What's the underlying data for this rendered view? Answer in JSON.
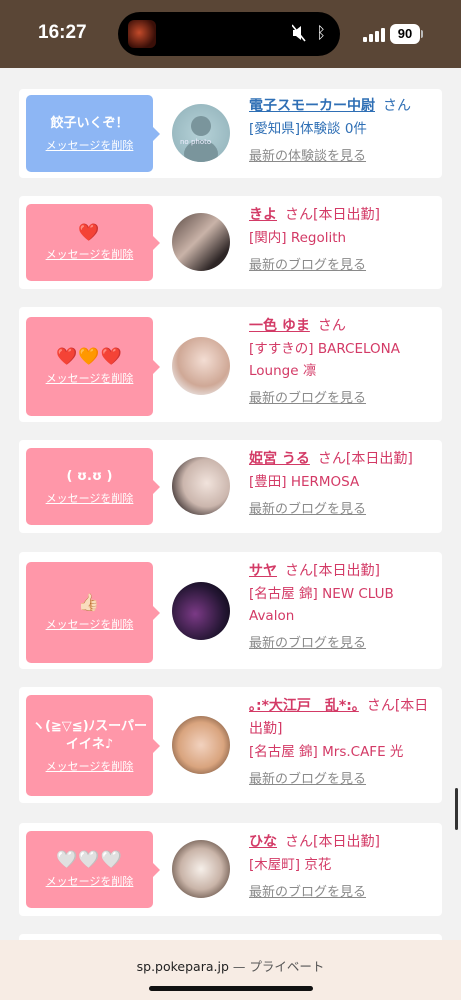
{
  "status_bar": {
    "time": "16:27",
    "battery": "90"
  },
  "entries": [
    {
      "message": "餃子いくぞ！",
      "delete_label": "メッセージを削除",
      "name": "電子スモーカー中尉",
      "suffix": "さん",
      "detail": "[愛知県]体験談 0件",
      "link": "最新の体験談を見る",
      "avatar_text": "no photo",
      "style": "blue"
    },
    {
      "message": "❤️",
      "delete_label": "メッセージを削除",
      "name": "きよ",
      "suffix": "さん[本日出勤]",
      "detail": "[関内] Regolith",
      "link": "最新のブログを見る",
      "style": "pink"
    },
    {
      "message": "❤️🧡❤️",
      "delete_label": "メッセージを削除",
      "name": "一色 ゆま",
      "suffix": "さん",
      "detail": "[すすきの] BARCELONA Lounge 凛",
      "link": "最新のブログを見る",
      "style": "pink"
    },
    {
      "message": "( ʊ.ʊ )",
      "delete_label": "メッセージを削除",
      "name": "姫宮 うる",
      "suffix": "さん[本日出勤]",
      "detail": "[豊田] HERMOSA",
      "link": "最新のブログを見る",
      "style": "pink"
    },
    {
      "message": "👍🏻",
      "delete_label": "メッセージを削除",
      "name": "サヤ",
      "suffix": "さん[本日出勤]",
      "detail": "[名古屋 錦] NEW CLUB Avalon",
      "link": "最新のブログを見る",
      "style": "pink"
    },
    {
      "message": "ヽ(≧▽≦)ﾉスーパーイイネ♪",
      "delete_label": "メッセージを削除",
      "name": "｡:*大江戸　乱*:｡",
      "suffix": "さん[本日出勤]",
      "detail": "[名古屋 錦] Mrs.CAFE 光",
      "link": "最新のブログを見る",
      "style": "pink"
    },
    {
      "message": "🤍🤍🤍",
      "delete_label": "メッセージを削除",
      "name": "ひな",
      "suffix": "さん[本日出勤]",
      "detail": "[木屋町] 京花",
      "link": "最新のブログを見る",
      "style": "pink"
    }
  ],
  "browser": {
    "domain": "sp.pokepara.jp",
    "separator": "—",
    "mode": "プライベート"
  },
  "colors": {
    "status_bar_bg": "#5a4636",
    "bubble_pink": "#ff97a9",
    "bubble_blue": "#8db6f4",
    "name_pink": "#d33a66",
    "name_blue": "#2f6fb5",
    "page_bg": "#f2f2f2"
  }
}
